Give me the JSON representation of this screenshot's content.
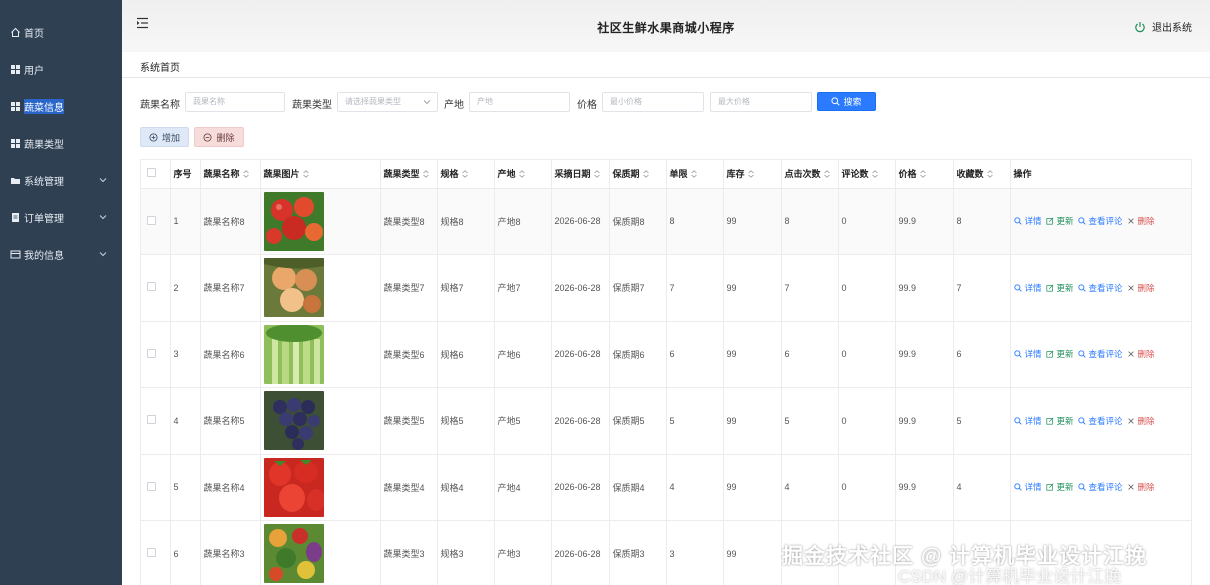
{
  "sidebar": {
    "items": [
      {
        "label": "首页",
        "icon": "home-icon",
        "has_chevron": false
      },
      {
        "label": "用户",
        "icon": "grid-icon",
        "has_chevron": false
      },
      {
        "label": "蔬菜信息",
        "icon": "grid-icon",
        "has_chevron": false,
        "active": true
      },
      {
        "label": "蔬果类型",
        "icon": "grid-icon",
        "has_chevron": false
      },
      {
        "label": "系统管理",
        "icon": "folder-icon",
        "has_chevron": true
      },
      {
        "label": "订单管理",
        "icon": "order-icon",
        "has_chevron": true
      },
      {
        "label": "我的信息",
        "icon": "card-icon",
        "has_chevron": true
      }
    ]
  },
  "header": {
    "title": "社区生鲜水果商城小程序",
    "logout_label": "退出系统"
  },
  "breadcrumb": "系统首页",
  "search": {
    "name_label": "蔬果名称",
    "name_placeholder": "蔬果名称",
    "type_label": "蔬果类型",
    "type_placeholder": "请选择蔬果类型",
    "origin_label": "产地",
    "origin_placeholder": "产地",
    "price_label": "价格",
    "min_price_placeholder": "最小价格",
    "max_price_placeholder": "最大价格",
    "search_button": "搜索"
  },
  "toolbar": {
    "add_label": "增加",
    "delete_label": "删除"
  },
  "table": {
    "columns": [
      "序号",
      "蔬果名称",
      "蔬果图片",
      "蔬果类型",
      "规格",
      "产地",
      "采摘日期",
      "保质期",
      "单限",
      "库存",
      "点击次数",
      "评论数",
      "价格",
      "收藏数",
      "操作"
    ],
    "action_labels": {
      "detail": "详情",
      "update": "更新",
      "comment": "查看评论",
      "remove": "删除"
    },
    "rows": [
      {
        "index": "1",
        "name": "蔬果名称8",
        "image": "tomatoes",
        "type": "蔬果类型8",
        "spec": "规格8",
        "origin": "产地8",
        "date": "2026-06-28",
        "shelf": "保质期8",
        "limit": "8",
        "stock": "99",
        "clicks": "8",
        "comments": "0",
        "price": "99.9",
        "favorites": "8"
      },
      {
        "index": "2",
        "name": "蔬果名称7",
        "image": "peaches",
        "type": "蔬果类型7",
        "spec": "规格7",
        "origin": "产地7",
        "date": "2026-06-28",
        "shelf": "保质期7",
        "limit": "7",
        "stock": "99",
        "clicks": "7",
        "comments": "0",
        "price": "99.9",
        "favorites": "7"
      },
      {
        "index": "3",
        "name": "蔬果名称6",
        "image": "celery",
        "type": "蔬果类型6",
        "spec": "规格6",
        "origin": "产地6",
        "date": "2026-06-28",
        "shelf": "保质期6",
        "limit": "6",
        "stock": "99",
        "clicks": "6",
        "comments": "0",
        "price": "99.9",
        "favorites": "6"
      },
      {
        "index": "4",
        "name": "蔬果名称5",
        "image": "grapes",
        "type": "蔬果类型5",
        "spec": "规格5",
        "origin": "产地5",
        "date": "2026-06-28",
        "shelf": "保质期5",
        "limit": "5",
        "stock": "99",
        "clicks": "5",
        "comments": "0",
        "price": "99.9",
        "favorites": "5"
      },
      {
        "index": "5",
        "name": "蔬果名称4",
        "image": "strawberries",
        "type": "蔬果类型4",
        "spec": "规格4",
        "origin": "产地4",
        "date": "2026-06-28",
        "shelf": "保质期4",
        "limit": "4",
        "stock": "99",
        "clicks": "4",
        "comments": "0",
        "price": "99.9",
        "favorites": "4"
      },
      {
        "index": "6",
        "name": "蔬果名称3",
        "image": "mixed-vegetables",
        "type": "蔬果类型3",
        "spec": "规格3",
        "origin": "产地3",
        "date": "2026-06-28",
        "shelf": "保质期3",
        "limit": "3",
        "stock": "99",
        "clicks": "",
        "comments": "",
        "price": "",
        "favorites": ""
      }
    ]
  },
  "watermark": {
    "line1": "掘金技术社区 @ 计算机毕业设计江挽",
    "line2": "CSDN @计算机毕业设计江挽"
  },
  "colors": {
    "sidebar_bg": "#2f4053",
    "primary": "#2a7bff",
    "update": "#1f8f5a",
    "danger": "#d9534f"
  }
}
